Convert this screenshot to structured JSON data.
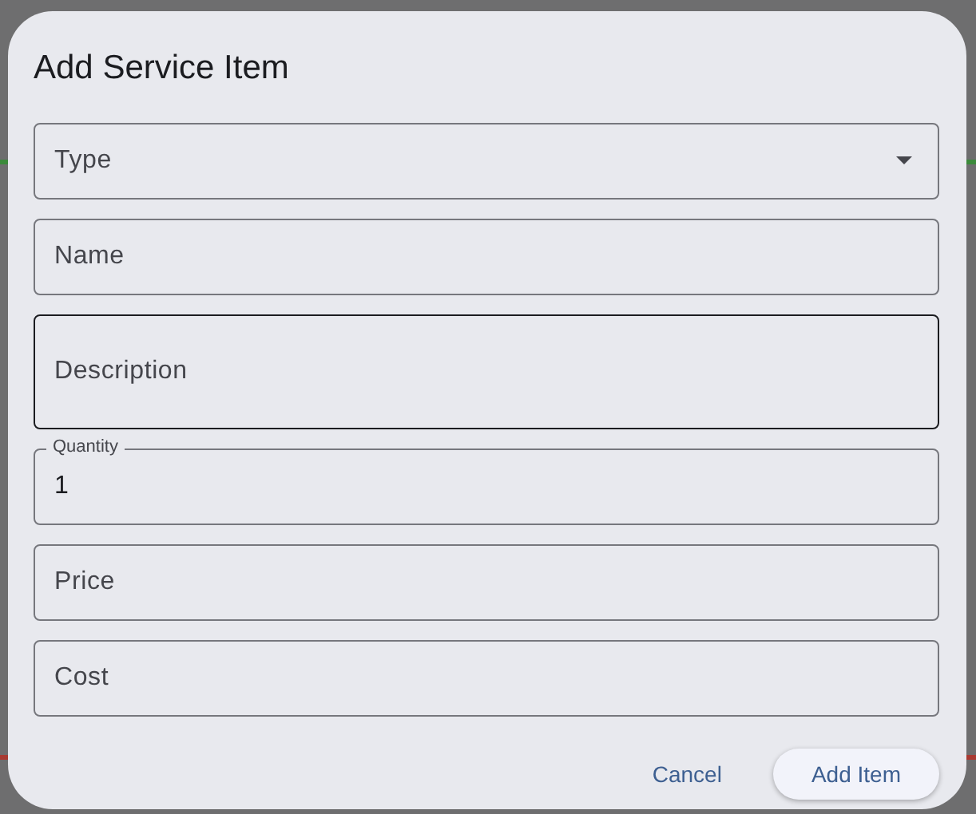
{
  "dialog": {
    "title": "Add Service Item",
    "fields": [
      {
        "kind": "select",
        "label": "Type",
        "hovered": false
      },
      {
        "kind": "text",
        "label": "Name",
        "hovered": false
      },
      {
        "kind": "multiline",
        "label": "Description",
        "hovered": true
      },
      {
        "kind": "text",
        "label": "Quantity",
        "value": "1",
        "hovered": false
      },
      {
        "kind": "text",
        "label": "Price",
        "hovered": false
      },
      {
        "kind": "text",
        "label": "Cost",
        "hovered": false
      }
    ],
    "buttons": [
      {
        "label": "Cancel",
        "kind": "text"
      },
      {
        "label": "Add Item",
        "kind": "tonal"
      }
    ]
  }
}
